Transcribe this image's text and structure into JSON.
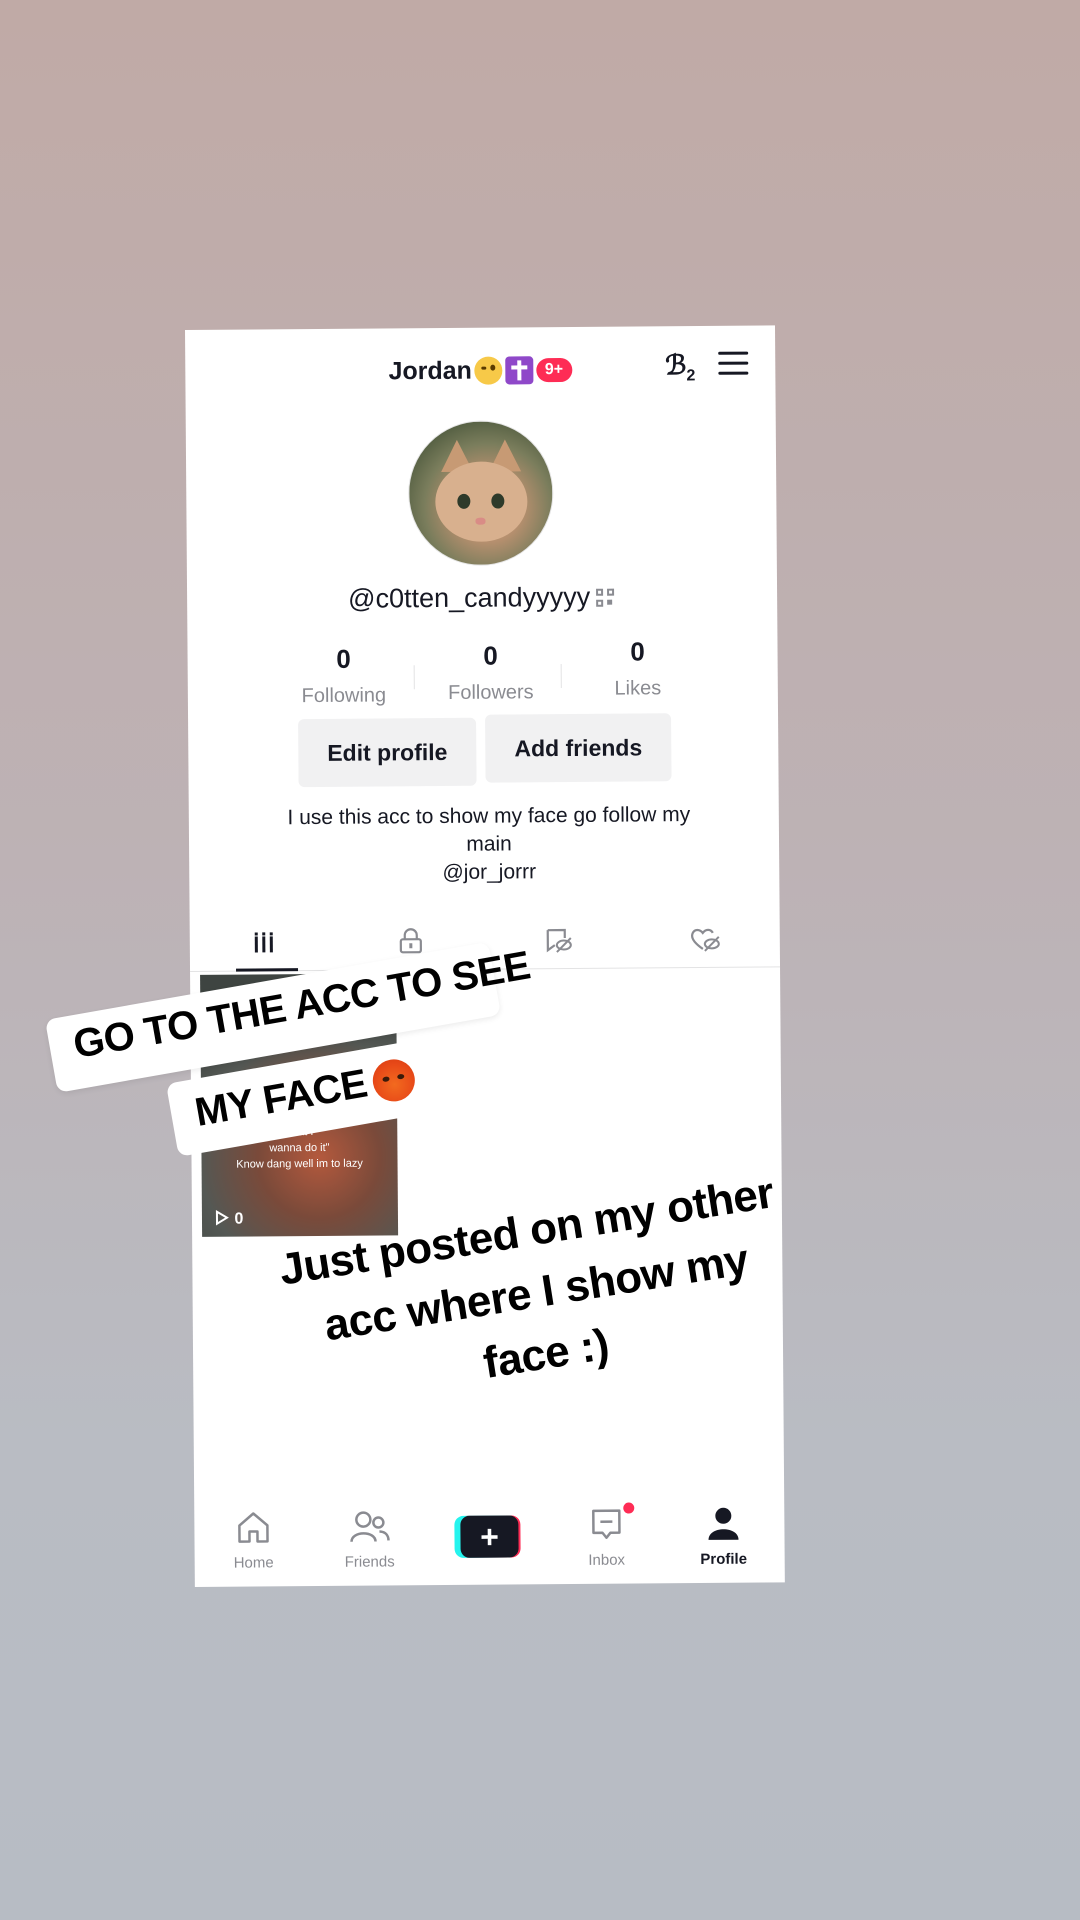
{
  "header": {
    "display_name": "Jordan",
    "notification_badge": "9+"
  },
  "profile": {
    "username": "@c0tten_candyyyyy",
    "stats": [
      {
        "value": "0",
        "label": "Following"
      },
      {
        "value": "0",
        "label": "Followers"
      },
      {
        "value": "0",
        "label": "Likes"
      }
    ],
    "edit_profile_label": "Edit profile",
    "add_friends_label": "Add friends",
    "bio_line1": "I use this acc to show my face go follow my",
    "bio_line2": "main",
    "bio_line3": "@jor_jorrr"
  },
  "tabs": [
    "videos-tab",
    "private-tab",
    "reposts-tab",
    "liked-tab"
  ],
  "video": {
    "caption_line1": "“that I",
    "caption_line2": "wanna do it\"",
    "caption_line3": "Know dang well im to lazy",
    "views": "0"
  },
  "bottom_nav": {
    "home": "Home",
    "friends": "Friends",
    "inbox": "Inbox",
    "profile": "Profile"
  },
  "overlay": {
    "sticker_line1": "GO TO THE ACC TO SEE",
    "sticker_line2": "MY FACE",
    "caption_line1": "Just posted on my other",
    "caption_line2": "acc where I show my",
    "caption_line3": "face :)"
  },
  "colors": {
    "accent": "#fe2c55",
    "text": "#161823",
    "muted": "#8a8b91"
  }
}
